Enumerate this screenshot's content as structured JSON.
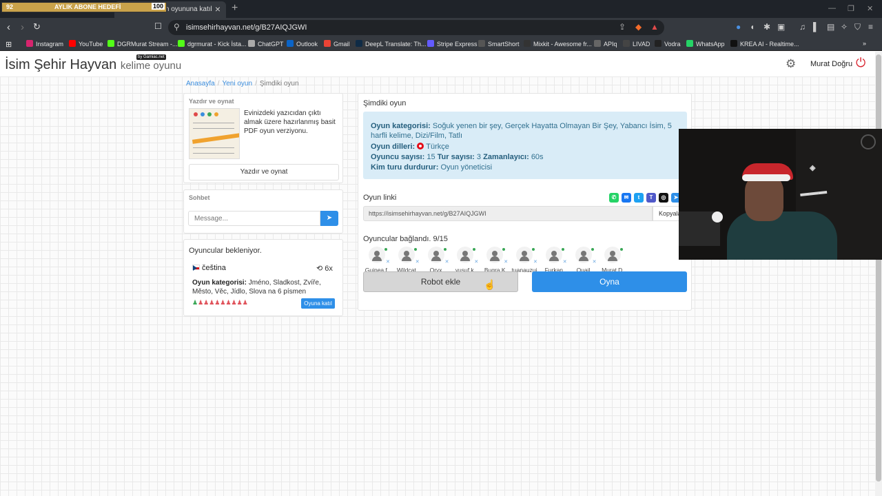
{
  "stream_overlay": {
    "goal_current": "92",
    "goal_label": "AYLIK ABONE HEDEFİ",
    "goal_max": "100"
  },
  "browser": {
    "tab_title": "...an oyununa katıl",
    "url": "isimsehirhayvan.net/g/B27AIQJGWI",
    "bookmarks": [
      "Instagram",
      "YouTube",
      "DGRMurat Stream -...",
      "dgrmurat - Kick İsta...",
      "ChatGPT",
      "Outlook",
      "Gmail",
      "DeepL Translate: Th...",
      "Stripe Express",
      "SmartShort",
      "Mixkit - Awesome fr...",
      "APIq",
      "LIVAD",
      "Vodra",
      "WhatsApp",
      "KREA AI - Realtime..."
    ]
  },
  "header": {
    "logo_main": "İsim Şehir Hayvan",
    "logo_sub": "kelime oyunu",
    "badge": "by Gamiac.net",
    "user_name": "Murat Doğru"
  },
  "breadcrumb": {
    "home": "Anasayfa",
    "new_game": "Yeni oyun",
    "current": "Şimdiki oyun"
  },
  "print_card": {
    "title": "Yazdır ve oynat",
    "description": "Evinizdeki yazıcıdan çıktı almak üzere hazırlanmış basit PDF oyun verziyonu.",
    "button": "Yazdır ve oynat"
  },
  "chat_card": {
    "title": "Sohbet",
    "placeholder": "Message..."
  },
  "waiting_card": {
    "title": "Oyuncular bekleniyor.",
    "language": "čeština",
    "rounds": "6x",
    "category_label": "Oyun kategorisi:",
    "category_value": "Jméno, Sladkost, Zvíře, Město, Věc, Jídlo, Slova na 6 písmen",
    "slots_filled": 1,
    "slots_total": 10,
    "join_button": "Oyuna katıl"
  },
  "current_game": {
    "title": "Şimdiki oyun",
    "category_label": "Oyun kategorisi:",
    "category_value": "Soğuk yenen bir şey, Gerçek Hayatta Olmayan Bir Şey, Yabancı İsim, 5 harfli kelime, Dizi/Film, Tatlı",
    "languages_label": "Oyun dilleri:",
    "languages_value": "Türkçe",
    "players_label": "Oyuncu sayısı:",
    "players_value": "15",
    "rounds_label": "Tur sayısı:",
    "rounds_value": "3",
    "timer_label": "Zamanlayıcı:",
    "timer_value": "60s",
    "stopper_label": "Kim turu durdurur:",
    "stopper_value": "Oyun yöneticisi",
    "link_label": "Oyun linki",
    "link_value": "https://isimsehirhayvan.net/g/B27AIQJGWI",
    "copy_button": "Kopyala",
    "connected_label": "Oyuncular bağlandı. 9/15",
    "players": [
      "Guinea f.",
      "Wildcat",
      "Oryx",
      "yusuf k.",
      "Bugra K",
      "tuanauzui",
      "Furkan",
      "Quail",
      "Murat D."
    ],
    "robot_button": "Robot ekle",
    "play_button": "Oyna"
  },
  "colors": {
    "primary": "#2e8fe8",
    "info_bg": "#d9ecf7",
    "info_text": "#31708f",
    "danger": "#d9232e",
    "success": "#3aa757"
  }
}
